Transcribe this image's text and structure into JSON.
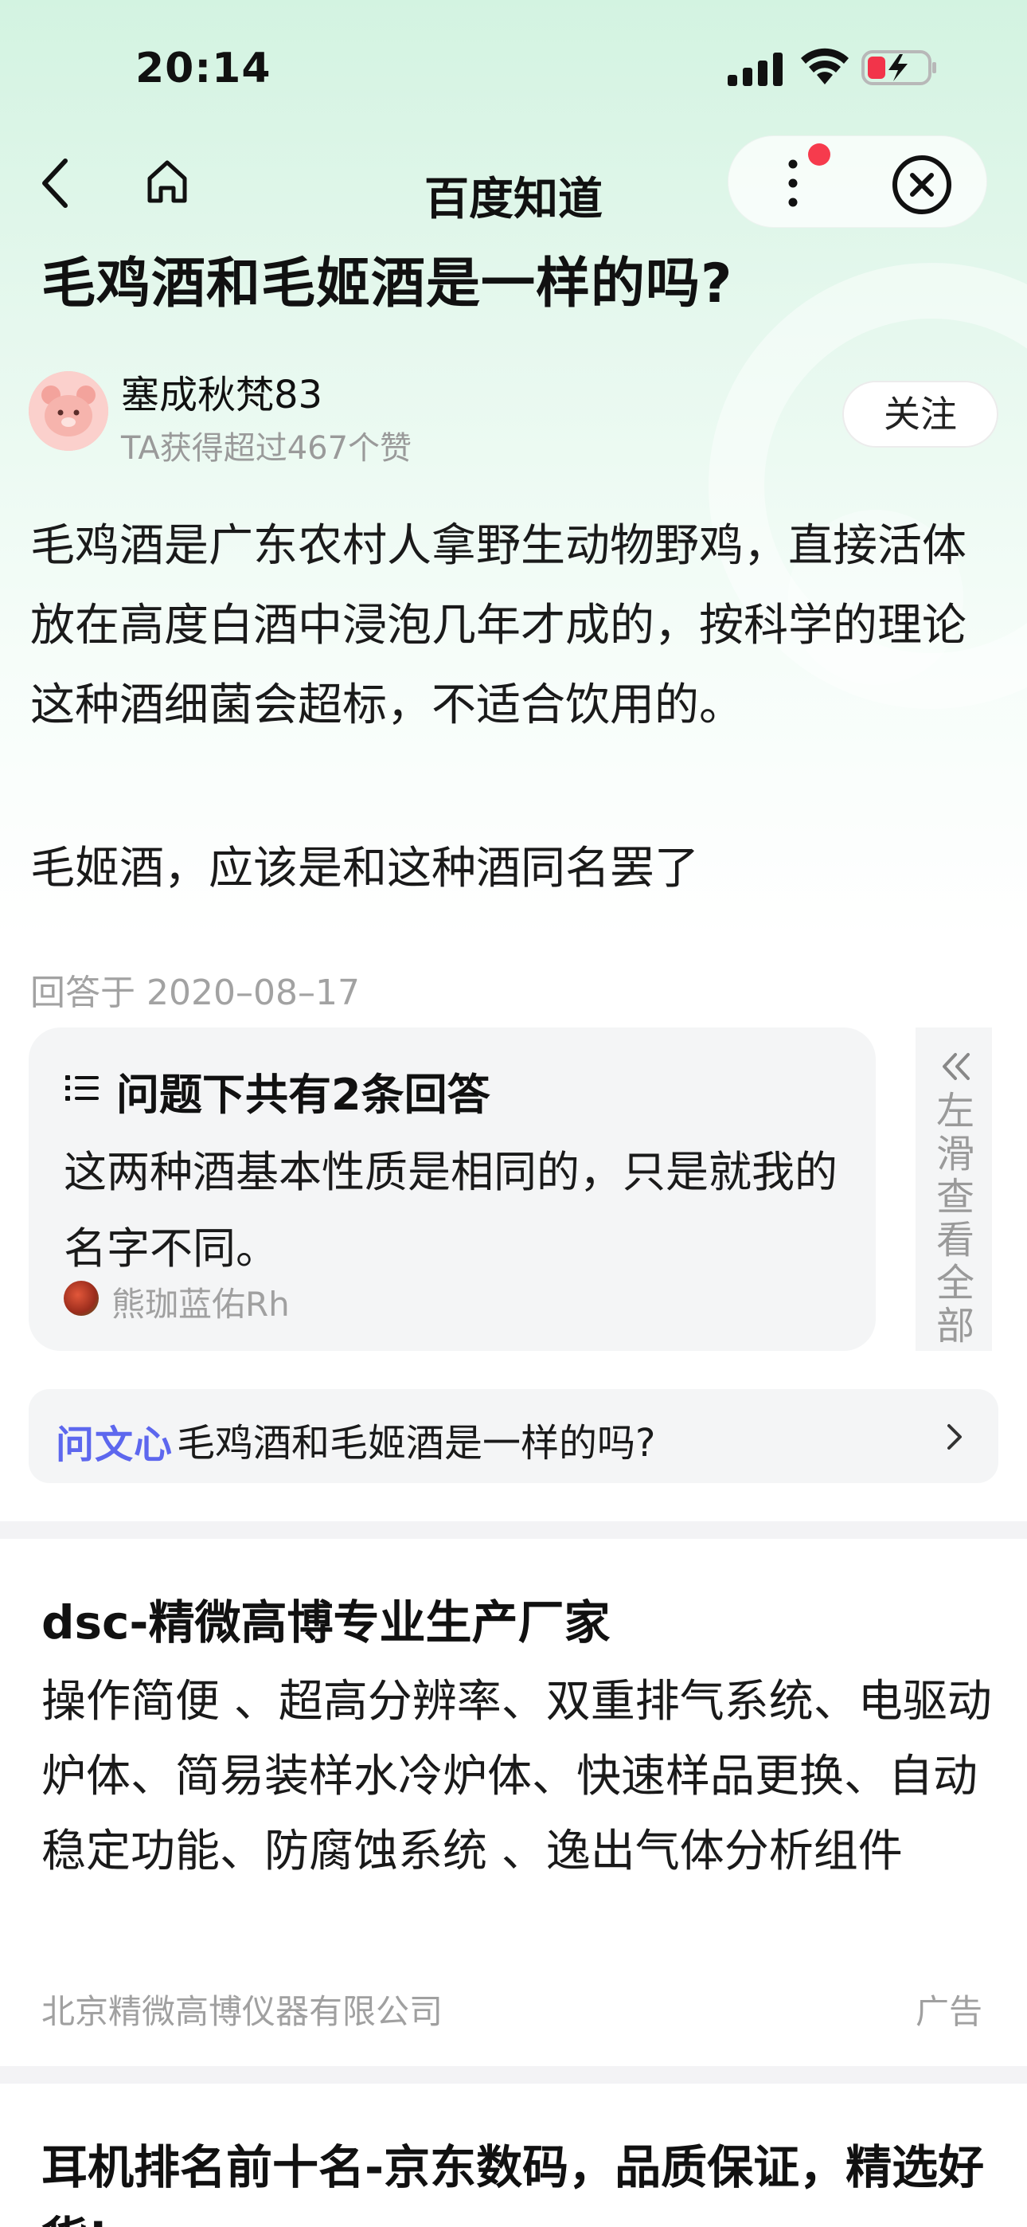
{
  "status_bar": {
    "time": "20:14"
  },
  "nav": {
    "title": "百度知道"
  },
  "question": {
    "title": "毛鸡酒和毛姬酒是一样的吗?"
  },
  "author": {
    "name": "塞成秋梵83",
    "likes": "TA获得超过467个赞",
    "follow_label": "关注"
  },
  "answer": {
    "paragraph1": "毛鸡酒是广东农村人拿野生动物野鸡，直接活体放在高度白酒中浸泡几年才成的，按科学的理论这种酒细菌会超标，不适合饮用的。",
    "paragraph2": "毛姬酒，应该是和这种酒同名罢了",
    "date": "回答于 2020–08–17"
  },
  "answers_card": {
    "heading": "问题下共有2条回答",
    "answer_text": "这两种酒基本性质是相同的，只是就我的名字不同。",
    "user": "熊珈蓝佑Rh",
    "swipe_hint": "左滑查看全部"
  },
  "wenxin": {
    "brand": "问文心",
    "query": "毛鸡酒和毛姬酒是一样的吗?"
  },
  "ad1": {
    "title": "dsc-精微高博专业生产厂家",
    "description": "操作简便 、超高分辨率、双重排气系统、电驱动炉体、简易装样水冷炉体、快速样品更换、自动稳定功能、防腐蚀系统 、逸出气体分析组件",
    "company": "北京精微高博仪器有限公司",
    "tag": "广告"
  },
  "ad2": {
    "title": "耳机排名前十名-京东数码，品质保证，精选好货!"
  },
  "icons": [
    "signal-icon",
    "wifi-icon",
    "battery-charging-icon",
    "back-icon",
    "home-icon",
    "more-icon",
    "close-icon",
    "list-icon",
    "double-chevron-left-icon",
    "chevron-right-icon"
  ],
  "colors": {
    "accent_green": "#d3f3e1",
    "wenxin_brand": "#5d67ee",
    "notification_dot": "#f63b4d"
  }
}
